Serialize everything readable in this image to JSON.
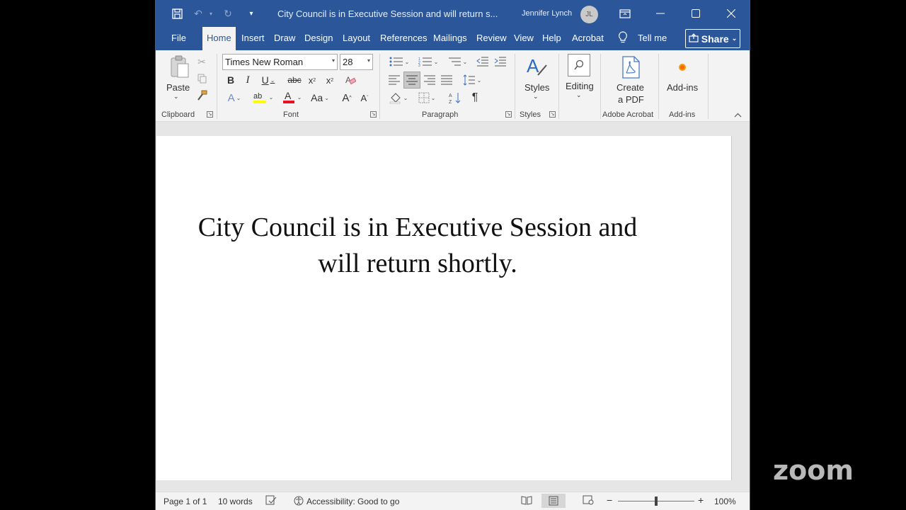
{
  "window": {
    "doc_title": "City Council is in Executive Session and will return s...",
    "user_name": "Jennifer Lynch",
    "user_initials": "JL"
  },
  "tabs": [
    "File",
    "Home",
    "Insert",
    "Draw",
    "Design",
    "Layout",
    "References",
    "Mailings",
    "Review",
    "View",
    "Help",
    "Acrobat"
  ],
  "active_tab": "Home",
  "tell_me": "Tell me",
  "share_label": "Share",
  "ribbon": {
    "clipboard": {
      "paste_label": "Paste",
      "group_label": "Clipboard"
    },
    "font": {
      "font_name": "Times New Roman",
      "font_size": "28",
      "group_label": "Font"
    },
    "paragraph": {
      "group_label": "Paragraph"
    },
    "styles": {
      "styles_label": "Styles",
      "group_label": "Styles"
    },
    "editing": {
      "editing_label": "Editing"
    },
    "acrobat": {
      "create_pdf_line1": "Create",
      "create_pdf_line2": "a PDF",
      "group_label": "Adobe Acrobat"
    },
    "addins": {
      "addins_label": "Add-ins",
      "group_label": "Add-ins"
    }
  },
  "document": {
    "line1": "City Council is in Executive Session and",
    "line2": "will return shortly."
  },
  "status": {
    "page": "Page 1 of 1",
    "words": "10 words",
    "accessibility": "Accessibility: Good to go",
    "zoom": "100%",
    "zoom_fraction": 0.5
  },
  "overlay_logo": "zoom",
  "colors": {
    "accent": "#2b579a",
    "font_color_bar": "#e81123",
    "highlight_bar": "#ffff00"
  }
}
